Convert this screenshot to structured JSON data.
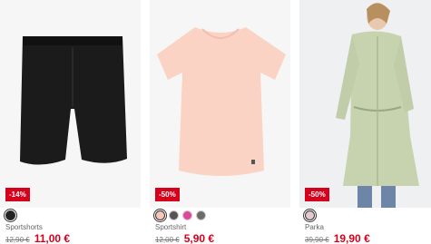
{
  "products": [
    {
      "badge": "-14%",
      "name": "Sportshorts",
      "old_price": "12,90 €",
      "new_price": "11,00 €",
      "swatches": [
        "#222222"
      ],
      "image_icon": "black-shorts"
    },
    {
      "badge": "-50%",
      "name": "Sportshirt",
      "old_price": "12,00 €",
      "new_price": "5,90 €",
      "swatches": [
        "#f9c7b8",
        "#555555",
        "#e0469b",
        "#6b6b6b"
      ],
      "image_icon": "peach-tshirt"
    },
    {
      "badge": "-50%",
      "name": "Parka",
      "old_price": "39,90 €",
      "new_price": "19,90 €",
      "swatches": [
        "#e6c9cd"
      ],
      "image_icon": "model-green-parka"
    }
  ],
  "colors": {
    "sale": "#d5001c",
    "background": "#ffffff"
  }
}
